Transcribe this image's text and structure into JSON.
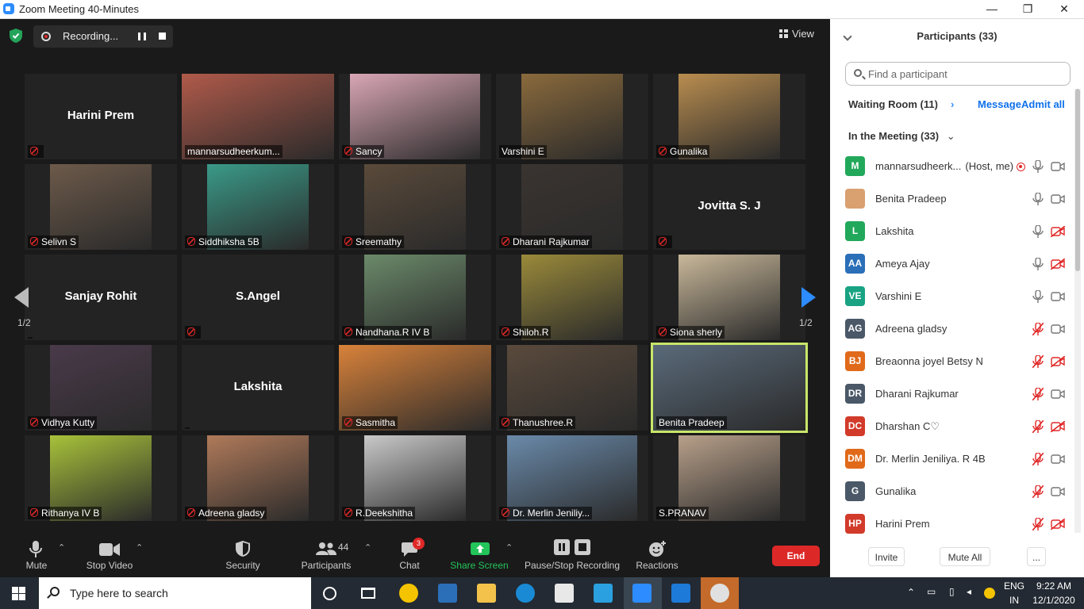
{
  "window": {
    "title": "Zoom Meeting 40-Minutes",
    "minimize": "—",
    "restore": "❐",
    "close": "✕"
  },
  "recording": {
    "label": "Recording..."
  },
  "view": {
    "label": "View"
  },
  "pager": {
    "left": "1/2",
    "right": "1/2"
  },
  "tiles": [
    {
      "name": "Harini Prem",
      "video": false,
      "muted": true
    },
    {
      "name": "mannarsudheerkum...",
      "video": true,
      "muted": false,
      "color": "#b05a4a"
    },
    {
      "name": "Sancy",
      "video": true,
      "muted": true,
      "color": "#d9a6b5"
    },
    {
      "name": "Varshini E",
      "video": true,
      "muted": false,
      "color": "#8a6a3c"
    },
    {
      "name": "Gunalika",
      "video": true,
      "muted": true,
      "color": "#b98d4f"
    },
    {
      "name": "Selivn S",
      "video": true,
      "muted": true,
      "color": "#6d5a4a"
    },
    {
      "name": "Siddhiksha 5B",
      "video": true,
      "muted": true,
      "color": "#3a9a88"
    },
    {
      "name": "Sreemathy",
      "video": true,
      "muted": true,
      "color": "#5a4a3a"
    },
    {
      "name": "Dharani Rajkumar",
      "video": true,
      "muted": true,
      "color": "#3a3430"
    },
    {
      "name": "Jovitta S. J",
      "video": false,
      "muted": true
    },
    {
      "name": "Sanjay Rohit",
      "video": false,
      "muted": false
    },
    {
      "name": "S.Angel",
      "video": false,
      "muted": true
    },
    {
      "name": "Nandhana.R IV B",
      "video": true,
      "muted": true,
      "color": "#6b8a6a"
    },
    {
      "name": "Shiloh.R",
      "video": true,
      "muted": true,
      "color": "#9a8a3a"
    },
    {
      "name": "Siona sherly",
      "video": true,
      "muted": true,
      "color": "#c9b89a"
    },
    {
      "name": "Vidhya Kutty",
      "video": true,
      "muted": true,
      "color": "#4a3a4a"
    },
    {
      "name": "Lakshita",
      "video": false,
      "muted": false
    },
    {
      "name": "Sasmitha",
      "video": true,
      "muted": true,
      "color": "#d9823a"
    },
    {
      "name": "Thanushree.R",
      "video": true,
      "muted": true,
      "color": "#5a4a3c"
    },
    {
      "name": "Benita Pradeep",
      "video": true,
      "muted": false,
      "color": "#5a6a7a",
      "active": true
    },
    {
      "name": "Rithanya IV B",
      "video": true,
      "muted": true,
      "color": "#a8c23a"
    },
    {
      "name": "Adreena gladsy",
      "video": true,
      "muted": true,
      "color": "#b07a5a"
    },
    {
      "name": "R.Deekshitha",
      "video": true,
      "muted": true,
      "color": "#c9c9c9"
    },
    {
      "name": "Dr. Merlin Jeniliy...",
      "video": true,
      "muted": true,
      "color": "#6a8aaa"
    },
    {
      "name": "S.PRANAV",
      "video": true,
      "muted": false,
      "color": "#b8a08a"
    }
  ],
  "toolbar": {
    "mute": "Mute",
    "stop_video": "Stop Video",
    "security": "Security",
    "participants": "Participants",
    "participants_count": "44",
    "chat": "Chat",
    "chat_badge": "3",
    "share_screen": "Share Screen",
    "recording": "Pause/Stop Recording",
    "reactions": "Reactions",
    "end": "End"
  },
  "panel": {
    "title": "Participants (33)",
    "search_placeholder": "Find a participant",
    "waiting_room": "Waiting Room (11)",
    "message": "Message",
    "admit_all": "Admit all",
    "in_meeting": "In the Meeting (33)",
    "participants": [
      {
        "initials": "M",
        "name": "mannarsudheerk...",
        "suffix": "(Host, me)",
        "color": "#22a85a",
        "mic": "on",
        "cam": "on",
        "rec": true
      },
      {
        "initials": "",
        "name": "Benita Pradeep",
        "color": "#d9a070",
        "mic": "on",
        "cam": "on",
        "photo": true
      },
      {
        "initials": "L",
        "name": "Lakshita",
        "color": "#22a85a",
        "mic": "on",
        "cam": "off"
      },
      {
        "initials": "AA",
        "name": "Ameya Ajay",
        "color": "#2b6fb8",
        "mic": "on",
        "cam": "off"
      },
      {
        "initials": "VE",
        "name": "Varshini E",
        "color": "#19a383",
        "mic": "on",
        "cam": "on"
      },
      {
        "initials": "AG",
        "name": "Adreena gladsy",
        "color": "#4a5868",
        "mic": "off",
        "cam": "on"
      },
      {
        "initials": "BJ",
        "name": "Breaonna joyel Betsy N",
        "color": "#e06a1a",
        "mic": "off",
        "cam": "off"
      },
      {
        "initials": "DR",
        "name": "Dharani Rajkumar",
        "color": "#4a5868",
        "mic": "off",
        "cam": "on"
      },
      {
        "initials": "DC",
        "name": "Dharshan C♡",
        "color": "#d23a2a",
        "mic": "off",
        "cam": "off"
      },
      {
        "initials": "DM",
        "name": "Dr. Merlin Jeniliya. R 4B",
        "color": "#e06a1a",
        "mic": "off",
        "cam": "on"
      },
      {
        "initials": "G",
        "name": "Gunalika",
        "color": "#4a5868",
        "mic": "off",
        "cam": "on"
      },
      {
        "initials": "HP",
        "name": "Harini Prem",
        "color": "#d23a2a",
        "mic": "off",
        "cam": "off"
      }
    ],
    "invite": "Invite",
    "mute_all": "Mute All",
    "more": "..."
  },
  "taskbar": {
    "search_placeholder": "Type here to search",
    "lang_top": "ENG",
    "lang_bottom": "IN",
    "time": "9:22 AM",
    "date": "12/1/2020"
  }
}
